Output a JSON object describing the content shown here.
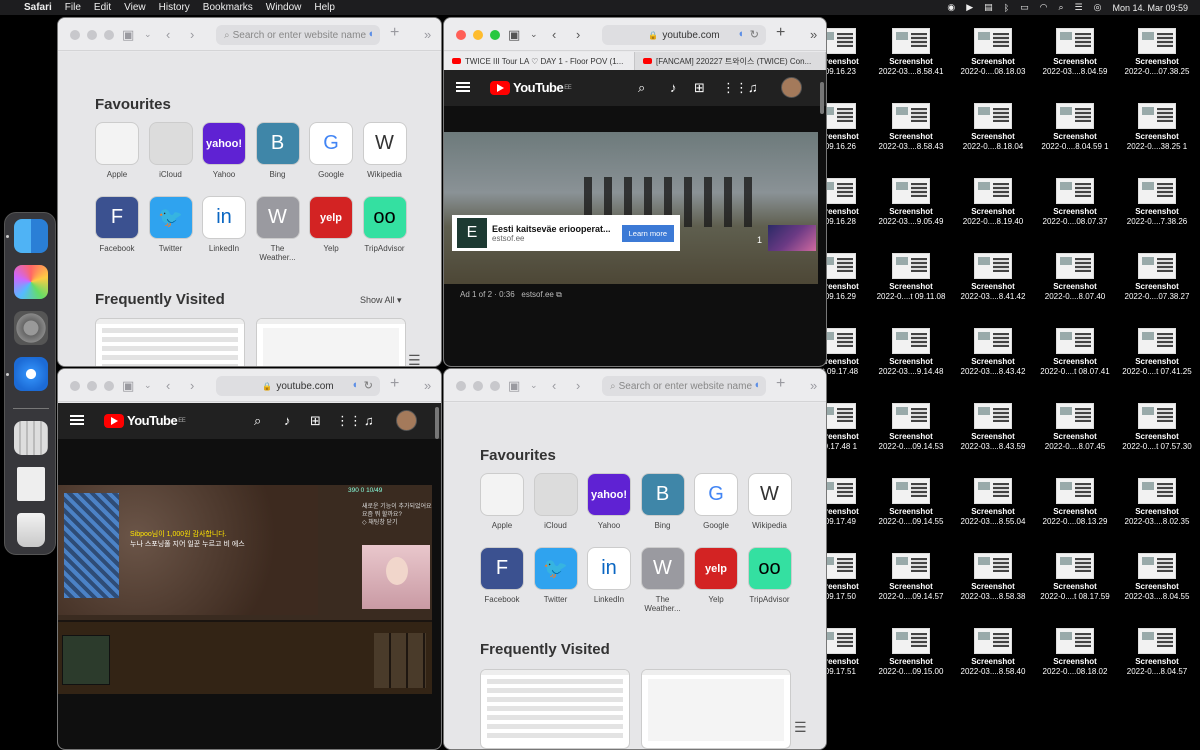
{
  "menubar": {
    "app": "Safari",
    "items": [
      "File",
      "Edit",
      "View",
      "History",
      "Bookmarks",
      "Window",
      "Help"
    ],
    "clock": "Mon 14. Mar  09:59"
  },
  "start_page": {
    "address_placeholder": "Search or enter website name",
    "favourites_title": "Favourites",
    "frequently_title": "Frequently Visited",
    "show_all": "Show All",
    "favourites": [
      {
        "label": "Apple",
        "glyph": "",
        "color": "#f3f3f3",
        "fg": "#777"
      },
      {
        "label": "iCloud",
        "glyph": "",
        "color": "#dcdcdc",
        "fg": "#888"
      },
      {
        "label": "Yahoo",
        "glyph": "yahoo!",
        "color": "#5f22d3",
        "fg": "#fff"
      },
      {
        "label": "Bing",
        "glyph": "B",
        "color": "#3f86a8",
        "fg": "#fff"
      },
      {
        "label": "Google",
        "glyph": "G",
        "color": "#ffffff",
        "fg": "#4285f4"
      },
      {
        "label": "Wikipedia",
        "glyph": "W",
        "color": "#ffffff",
        "fg": "#333"
      },
      {
        "label": "Facebook",
        "glyph": "F",
        "color": "#3b5190",
        "fg": "#fff"
      },
      {
        "label": "Twitter",
        "glyph": "🐦",
        "color": "#2fa3ef",
        "fg": "#fff"
      },
      {
        "label": "LinkedIn",
        "glyph": "in",
        "color": "#ffffff",
        "fg": "#0a66c2"
      },
      {
        "label": "The Weather...",
        "glyph": "W",
        "color": "#9a9aa0",
        "fg": "#fff"
      },
      {
        "label": "Yelp",
        "glyph": "yelp",
        "color": "#d32323",
        "fg": "#fff"
      },
      {
        "label": "TripAdvisor",
        "glyph": "oo",
        "color": "#34e0a1",
        "fg": "#000"
      }
    ]
  },
  "youtube_top": {
    "url": "youtube.com",
    "tabs": [
      "TWICE III Tour LA ♡ DAY 1 - Floor POV (1...",
      "[FANCAM] 220227 트와이스 (TWICE) Con..."
    ],
    "logo": "YouTube",
    "region": "EE",
    "ad": {
      "letter": "E",
      "title": "Eesti kaitseväe eriooperat...",
      "domain": "estsof.ee",
      "cta": "Learn more",
      "info": "Ad 1 of 2 · 0:36",
      "info_link": "estsof.ee",
      "count": "1"
    }
  },
  "youtube_bottom": {
    "url": "youtube.com",
    "logo": "YouTube",
    "region": "EE",
    "overlay_line1": "Sibpoo님이 1,000원 감사합니다.",
    "overlay_line2": "누나 스포닝풀 지어 일꾼 누르고 비 에스",
    "resources": "390   0   10/49",
    "side_lines": [
      "새로운 기능이 추가되었어요",
      "요즘 뭐 할까요?",
      "◇ 채팅창 닫기"
    ]
  },
  "desktop_icons": [
    [
      "Screenshot",
      "...09.16.23"
    ],
    [
      "Screenshot",
      "2022-03....8.58.41"
    ],
    [
      "Screenshot",
      "2022-0....08.18.03"
    ],
    [
      "Screenshot",
      "2022-03....8.04.59"
    ],
    [
      "Screenshot",
      "2022-0....07.38.25"
    ],
    [
      "Screenshot",
      "...09.16.26"
    ],
    [
      "Screenshot",
      "2022-03....8.58.43"
    ],
    [
      "Screenshot",
      "2022-0....8.18.04"
    ],
    [
      "Screenshot",
      "2022-0....8.04.59 1"
    ],
    [
      "Screenshot",
      "2022-0....38.25 1"
    ],
    [
      "Screenshot",
      "...09.16.28"
    ],
    [
      "Screenshot",
      "2022-03....9.05.49"
    ],
    [
      "Screenshot",
      "2022-0....8.19.40"
    ],
    [
      "Screenshot",
      "2022-0....08.07.37"
    ],
    [
      "Screenshot",
      "2022-0....7.38.26"
    ],
    [
      "Screenshot",
      "...09.16.29"
    ],
    [
      "Screenshot",
      "2022-0....t 09.11.08"
    ],
    [
      "Screenshot",
      "2022-03....8.41.42"
    ],
    [
      "Screenshot",
      "2022-0....8.07.40"
    ],
    [
      "Screenshot",
      "2022-0....07.38.27"
    ],
    [
      "Screenshot",
      "...t 09.17.48"
    ],
    [
      "Screenshot",
      "2022-03....9.14.48"
    ],
    [
      "Screenshot",
      "2022-03....8.43.42"
    ],
    [
      "Screenshot",
      "2022-0....t 08.07.41"
    ],
    [
      "Screenshot",
      "2022-0....t 07.41.25"
    ],
    [
      "Screenshot",
      "...9.17.48 1"
    ],
    [
      "Screenshot",
      "2022-0....09.14.53"
    ],
    [
      "Screenshot",
      "2022-03....8.43.59"
    ],
    [
      "Screenshot",
      "2022-0....8.07.45"
    ],
    [
      "Screenshot",
      "2022-0....t 07.57.30"
    ],
    [
      "Screenshot",
      "...09.17.49"
    ],
    [
      "Screenshot",
      "2022-0....09.14.55"
    ],
    [
      "Screenshot",
      "2022-03....8.55.04"
    ],
    [
      "Screenshot",
      "2022-0....08.13.29"
    ],
    [
      "Screenshot",
      "2022-03....8.02.35"
    ],
    [
      "Screenshot",
      "...09.17.50"
    ],
    [
      "Screenshot",
      "2022-0....09.14.57"
    ],
    [
      "Screenshot",
      "2022-03....8.58.38"
    ],
    [
      "Screenshot",
      "2022-0....t 08.17.59"
    ],
    [
      "Screenshot",
      "2022-03....8.04.55"
    ],
    [
      "Screenshot",
      "...09.17.51"
    ],
    [
      "Screenshot",
      "2022-0....09.15.00"
    ],
    [
      "Screenshot",
      "2022-03....8.58.40"
    ],
    [
      "Screenshot",
      "2022-0....08.18.02"
    ],
    [
      "Screenshot",
      "2022-0....8.04.57"
    ]
  ],
  "colors": {
    "yt_red": "#ff0000",
    "safari_accent": "#3c7ad6",
    "desktop": "#000000"
  }
}
